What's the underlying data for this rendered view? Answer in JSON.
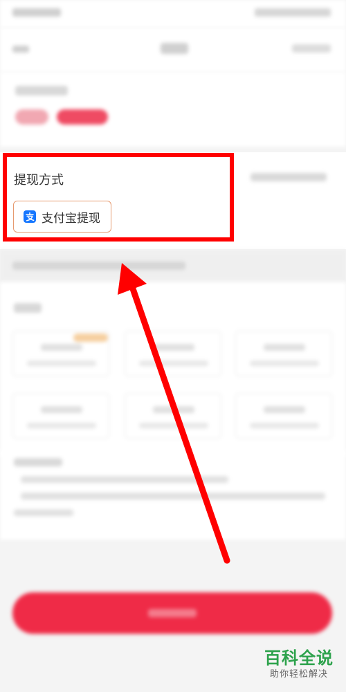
{
  "withdraw_method": {
    "title": "提现方式",
    "alipay_option": {
      "label": "支付宝提现",
      "icon": "alipay-icon",
      "border_color": "#e69a6f"
    }
  },
  "annotation": {
    "highlight_color": "#ff0000",
    "arrow_color": "#ff0000"
  },
  "watermark": {
    "line1": "百科全说",
    "line2": "助你轻松解决"
  },
  "colors": {
    "accent_red": "#ef2b47",
    "alipay_blue": "#1677ff"
  }
}
